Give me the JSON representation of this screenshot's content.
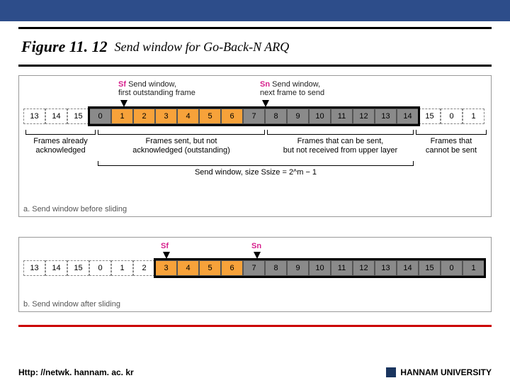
{
  "header": {
    "figure_number": "Figure 11. 12",
    "caption": "Send window for Go-Back-N ARQ"
  },
  "pointers": {
    "sf": {
      "symbol": "Sf",
      "label": "Send window,\nfirst outstanding frame"
    },
    "sn": {
      "symbol": "Sn",
      "label": "Send window,\nnext frame to send"
    }
  },
  "diagramA": {
    "strip": {
      "before": [
        "13",
        "14",
        "15"
      ],
      "ack": [
        "0"
      ],
      "outstanding": [
        "1",
        "2",
        "3",
        "4",
        "5",
        "6"
      ],
      "canSend": [
        "7",
        "8",
        "9",
        "10",
        "11",
        "12",
        "13",
        "14"
      ],
      "after": [
        "15",
        "0",
        "1"
      ]
    },
    "braces": {
      "acknowledged": "Frames already\nacknowledged",
      "outstanding": "Frames sent, but not\nacknowledged (outstanding)",
      "canSend": "Frames that can be sent,\nbut not received from upper layer",
      "cannotSend": "Frames that\ncannot be sent"
    },
    "windowSize": "Send window, size Ssize = 2^m − 1",
    "subcaption": "a. Send window before sliding"
  },
  "diagramB": {
    "strip": {
      "before": [
        "13",
        "14",
        "15",
        "0",
        "1",
        "2"
      ],
      "outstanding": [
        "3",
        "4",
        "5",
        "6"
      ],
      "canSend": [
        "7",
        "8",
        "9",
        "10",
        "11",
        "12",
        "13",
        "14",
        "15",
        "0",
        "1"
      ],
      "after": []
    },
    "subcaption": "b. Send window after sliding"
  },
  "accent_hex": "#c00",
  "footer": {
    "left": "Http: //netwk. hannam. ac. kr",
    "right": "HANNAM  UNIVERSITY"
  }
}
